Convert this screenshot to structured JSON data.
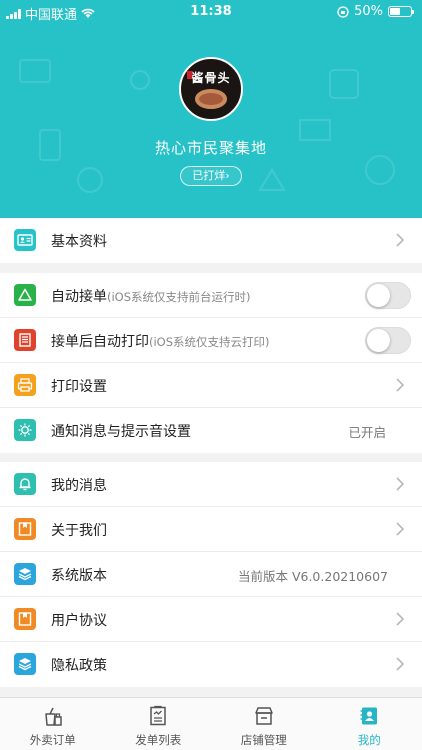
{
  "status_bar": {
    "carrier": "中国联通",
    "time": "11:38",
    "battery": "50%",
    "battery_level": 0.5
  },
  "profile": {
    "store_name": "热心市民聚集地",
    "status": "已打烊",
    "status_arrow": "›",
    "logo_text": "酱骨头"
  },
  "colors": {
    "accent": "#26c2c8",
    "active_tab": "#26b5c6",
    "icon_teal": "#27c3c9",
    "icon_green": "#2ab24a",
    "icon_red": "#e0432b",
    "icon_orange": "#f4a11d",
    "icon_tealgreen": "#2ebfb0",
    "icon_orange2": "#f08a24",
    "icon_blue": "#2aa6dc"
  },
  "section1": [
    {
      "label": "基本资料",
      "icon": "id-card-icon"
    }
  ],
  "section2": [
    {
      "label": "自动接单",
      "hint": "(iOS系统仅支持前台运行时)",
      "icon": "triangle-icon",
      "toggle_on": false
    },
    {
      "label": "接单后自动打印",
      "hint": "(iOS系统仅支持云打印)",
      "icon": "receipt-icon",
      "toggle_on": false
    },
    {
      "label": "打印设置",
      "icon": "printer-icon"
    },
    {
      "label": "通知消息与提示音设置",
      "value": "已开启",
      "icon": "bulb-icon"
    }
  ],
  "section3": [
    {
      "label": "我的消息",
      "icon": "bell-icon"
    },
    {
      "label": "关于我们",
      "icon": "bookmark-icon"
    },
    {
      "label": "系统版本",
      "value": "当前版本 V6.0.20210607",
      "icon": "layers-icon"
    },
    {
      "label": "用户协议",
      "icon": "bookmark-icon"
    },
    {
      "label": "隐私政策",
      "icon": "layers-icon"
    }
  ],
  "tabs": [
    {
      "label": "外卖订单",
      "icon": "takeout-icon",
      "active": false
    },
    {
      "label": "发单列表",
      "icon": "list-icon",
      "active": false
    },
    {
      "label": "店铺管理",
      "icon": "store-icon",
      "active": false
    },
    {
      "label": "我的",
      "icon": "profile-icon",
      "active": true
    }
  ]
}
